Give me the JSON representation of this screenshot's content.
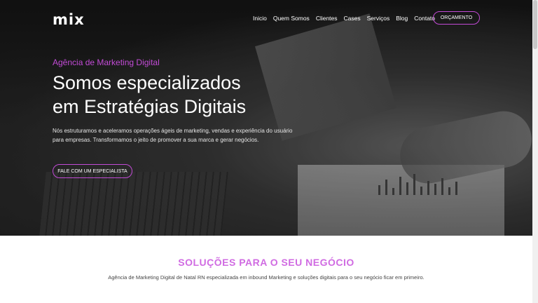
{
  "header": {
    "logo_text": "mix",
    "nav": [
      "Inicio",
      "Quem Somos",
      "Clientes",
      "Cases",
      "Serviços",
      "Blog",
      "Contato"
    ],
    "cta_label": "ORÇAMENTO"
  },
  "hero": {
    "eyebrow": "Agência de Marketing Digital",
    "title_line1": "Somos especializados",
    "title_line2": "em Estratégias Digitais",
    "lead": "Nós estruturamos e aceleramos operações ágeis de marketing, vendas e experiência do usuário para empresas. Transformamos o jeito de promover a sua marca e gerar negócios.",
    "cta_label": "FALE COM UM ESPECIALISTA"
  },
  "solutions": {
    "title": "SOLUÇÕES PARA O SEU NEGÓCIO",
    "text": "Agência de Marketing Digital de Natal RN especializada em inbound Marketing e soluções digitais para o seu negócio ficar em primeiro."
  },
  "colors": {
    "accent": "#c24bd6",
    "heading_accent": "#d06be2"
  }
}
